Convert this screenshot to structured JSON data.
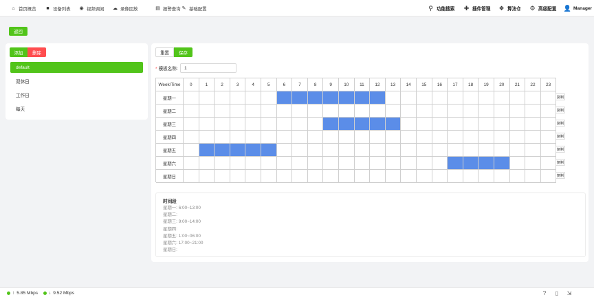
{
  "nav": {
    "left": [
      {
        "icon": "home-icon",
        "glyph": "⌂",
        "label": "首页概览"
      },
      {
        "icon": "device-icon",
        "glyph": "■",
        "label": "设备列表"
      },
      {
        "icon": "video-icon",
        "glyph": "◉",
        "label": "视频调阅"
      },
      {
        "icon": "cloud-icon",
        "glyph": "☁",
        "label": "录像回放"
      },
      {
        "icon": "alarm-icon",
        "glyph": "▤",
        "label": "报警查询"
      },
      {
        "icon": "edit-icon",
        "glyph": "✎",
        "label": "基础配置"
      }
    ],
    "right": [
      {
        "icon": "search-icon",
        "glyph": "⚲",
        "label": "功能搜索"
      },
      {
        "icon": "plugin-icon",
        "glyph": "✚",
        "label": "插件管理"
      },
      {
        "icon": "dropbox-icon",
        "glyph": "❖",
        "label": "算法仓"
      },
      {
        "icon": "gear-icon",
        "glyph": "⚙",
        "label": "高级配置"
      },
      {
        "icon": "user-icon",
        "glyph": "👤",
        "label": "Manager"
      }
    ]
  },
  "back_label": "返回",
  "sidebar": {
    "add_label": "添加",
    "delete_label": "删除",
    "items": [
      "default",
      "双休日",
      "工作日",
      "每天"
    ],
    "active_index": 0
  },
  "toolbar": {
    "reset_label": "重置",
    "save_label": "保存"
  },
  "form": {
    "name_label": "模板名称:",
    "name_value": "1"
  },
  "schedule": {
    "corner_label": "Week/Time",
    "hours": [
      "0",
      "1",
      "2",
      "3",
      "4",
      "5",
      "6",
      "7",
      "8",
      "9",
      "10",
      "11",
      "12",
      "13",
      "14",
      "15",
      "16",
      "17",
      "18",
      "19",
      "20",
      "21",
      "22",
      "23"
    ],
    "clear_label": "复制",
    "days": [
      {
        "label": "星期一",
        "selected": [
          6,
          7,
          8,
          9,
          10,
          11,
          12
        ]
      },
      {
        "label": "星期二",
        "selected": []
      },
      {
        "label": "星期三",
        "selected": [
          9,
          10,
          11,
          12,
          13
        ]
      },
      {
        "label": "星期四",
        "selected": []
      },
      {
        "label": "星期五",
        "selected": [
          1,
          2,
          3,
          4,
          5
        ]
      },
      {
        "label": "星期六",
        "selected": [
          17,
          18,
          19,
          20
        ]
      },
      {
        "label": "星期日",
        "selected": []
      }
    ],
    "selected_color": "#5b8de8"
  },
  "summary": {
    "title": "时间段",
    "lines": [
      "星期一: 6:00~13:00",
      "星期二:",
      "星期三: 9:00~14:00",
      "星期四:",
      "星期五: 1:00~06:00",
      "星期六: 17:00~21:00",
      "星期日:"
    ]
  },
  "status": {
    "upload": "5.85 Mbps",
    "download": "9.52 Mbps",
    "upload_icon": "arrow-up-icon",
    "download_icon": "arrow-down-icon"
  },
  "colors": {
    "accent": "#52c41a",
    "danger": "#ff4d4f"
  }
}
